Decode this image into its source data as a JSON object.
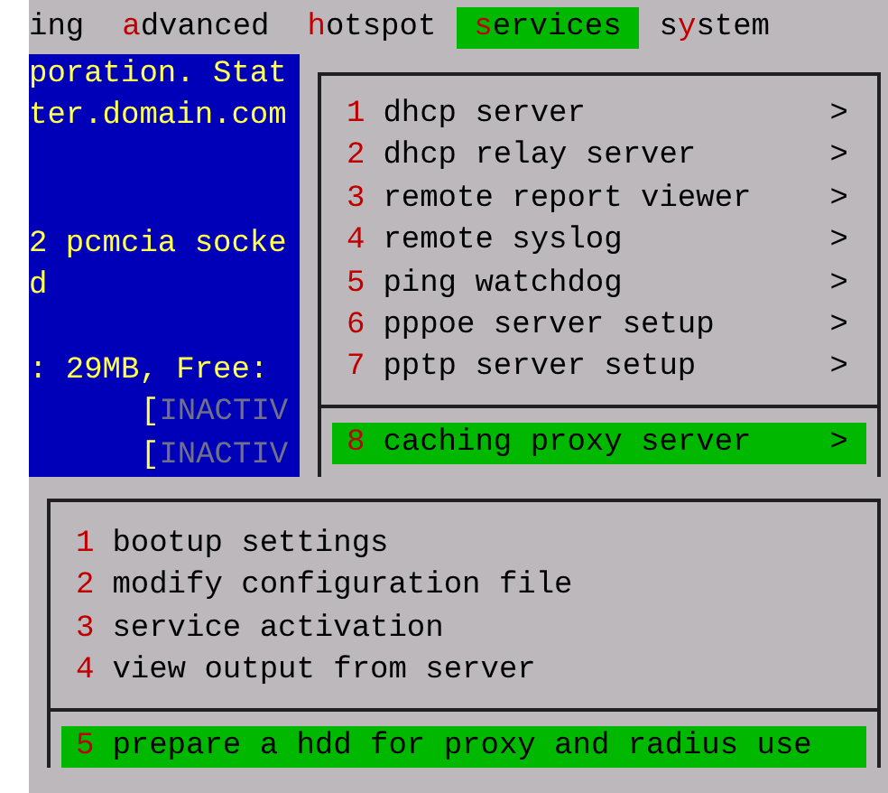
{
  "menu_bar": [
    {
      "before": "ing",
      "selected": false
    },
    {
      "key": "a",
      "after": "dvanced",
      "selected": false
    },
    {
      "key": "h",
      "after": "otspot",
      "selected": false
    },
    {
      "key": "s",
      "after": "ervices",
      "selected": true
    },
    {
      "before": "s",
      "key": "y",
      "after": "stem",
      "selected": false
    }
  ],
  "console": {
    "lines": [
      {
        "kind": "text",
        "text": "poration. Stat"
      },
      {
        "kind": "text",
        "text": "ter.domain.com"
      },
      {
        "kind": "blank"
      },
      {
        "kind": "blank"
      },
      {
        "kind": "text",
        "text": "2 pcmcia socke"
      },
      {
        "kind": "text",
        "text": "d"
      },
      {
        "kind": "blank"
      },
      {
        "kind": "text",
        "text": ": 29MB, Free:"
      },
      {
        "kind": "status",
        "bracket": "[",
        "text": "INACTIV"
      },
      {
        "kind": "status",
        "bracket": "[",
        "text": "INACTIV"
      }
    ]
  },
  "services_menu": {
    "items": [
      {
        "number": "1",
        "label": "dhcp server",
        "arrow": ">",
        "separator_before": false,
        "selected": false
      },
      {
        "number": "2",
        "label": "dhcp relay server",
        "arrow": ">",
        "separator_before": false,
        "selected": false
      },
      {
        "number": "3",
        "label": "remote report viewer",
        "arrow": ">",
        "separator_before": false,
        "selected": false
      },
      {
        "number": "4",
        "label": "remote syslog",
        "arrow": ">",
        "separator_before": false,
        "selected": false
      },
      {
        "number": "5",
        "label": "ping watchdog",
        "arrow": ">",
        "separator_before": false,
        "selected": false
      },
      {
        "number": "6",
        "label": "pppoe server setup",
        "arrow": ">",
        "separator_before": false,
        "selected": false
      },
      {
        "number": "7",
        "label": "pptp server setup",
        "arrow": ">",
        "separator_before": false,
        "selected": false
      },
      {
        "number": "8",
        "label": "caching proxy server",
        "arrow": ">",
        "separator_before": true,
        "selected": true
      }
    ]
  },
  "proxy_menu": {
    "items": [
      {
        "number": "1",
        "label": "bootup settings",
        "separator_before": false,
        "selected": false
      },
      {
        "number": "2",
        "label": "modify configuration file",
        "separator_before": false,
        "selected": false
      },
      {
        "number": "3",
        "label": "service activation",
        "separator_before": false,
        "selected": false
      },
      {
        "number": "4",
        "label": "view output from server",
        "separator_before": false,
        "selected": false
      },
      {
        "number": "5",
        "label": "prepare a hdd for proxy and radius use",
        "separator_before": true,
        "selected": true
      }
    ]
  }
}
